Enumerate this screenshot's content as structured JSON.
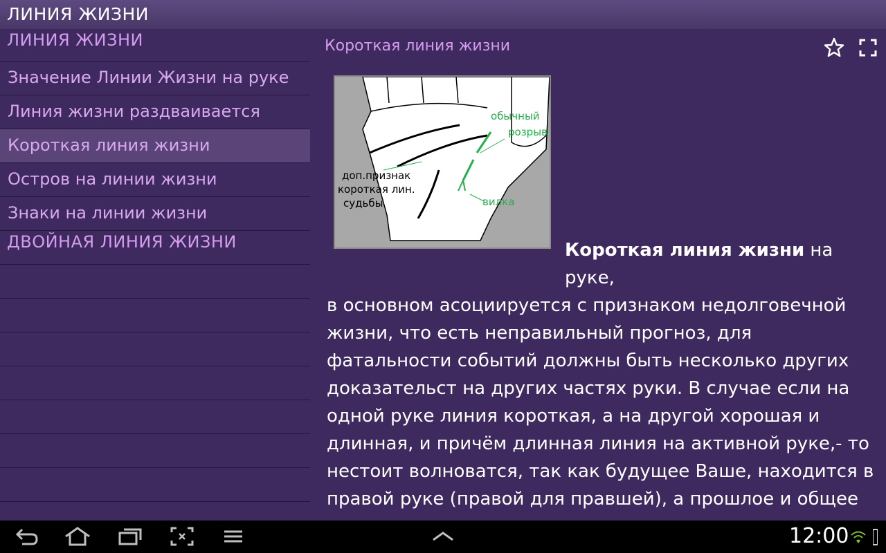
{
  "app": {
    "title": "ЛИНИЯ ЖИЗНИ"
  },
  "sidebar": {
    "items": [
      {
        "label": "ЛИНИЯ ЖИЗНИ",
        "type": "header"
      },
      {
        "label": "Значение Линии Жизни на руке",
        "type": "item"
      },
      {
        "label": "Линия жизни раздваивается",
        "type": "item"
      },
      {
        "label": "Короткая линия жизни",
        "type": "item",
        "selected": true
      },
      {
        "label": "Остров на линии жизни",
        "type": "item"
      },
      {
        "label": "Знаки на линии жизни",
        "type": "item"
      },
      {
        "label": "ДВОЙНАЯ ЛИНИЯ ЖИЗНИ",
        "type": "header"
      }
    ]
  },
  "content": {
    "title": "Короткая линия жизни",
    "image_labels": {
      "normal": "обычный",
      "gap": "розрыв",
      "extra_sign_1": "доп.признак",
      "extra_sign_2": "короткая лин.",
      "extra_sign_3": "судьбы",
      "fork": "вилка"
    },
    "article_bold": "Короткая линия жизни",
    "article_after_bold": " на руке,",
    "article_rest": "в основном асоциируется с признаком недолговечной жизни, что есть неправильный прогноз, для фатальности событий должны быть несколько других доказательст на других частях руки. В случае если на одной руке линия короткая, а на другой хорошая и длинная, и причём длинная линия на активной руке,- то нестоит волноватся, так как будущее Ваше, находится в правой руке (правой для правшей), а прошлое и общее предназначенье, инкстинкты с которыми рождаются люди, находятся в левой руке. Но"
  },
  "status": {
    "time": "12:00"
  },
  "colors": {
    "background": "#3f2a5e",
    "accent": "#d49cef",
    "selected": "#5a4478",
    "annotation": "#22b04a"
  },
  "icons": [
    "star-icon",
    "fullscreen-icon",
    "back-icon",
    "home-icon",
    "recent-apps-icon",
    "screenshot-icon",
    "menu-icon",
    "up-arrow-icon",
    "wifi-icon",
    "signal-icon"
  ]
}
